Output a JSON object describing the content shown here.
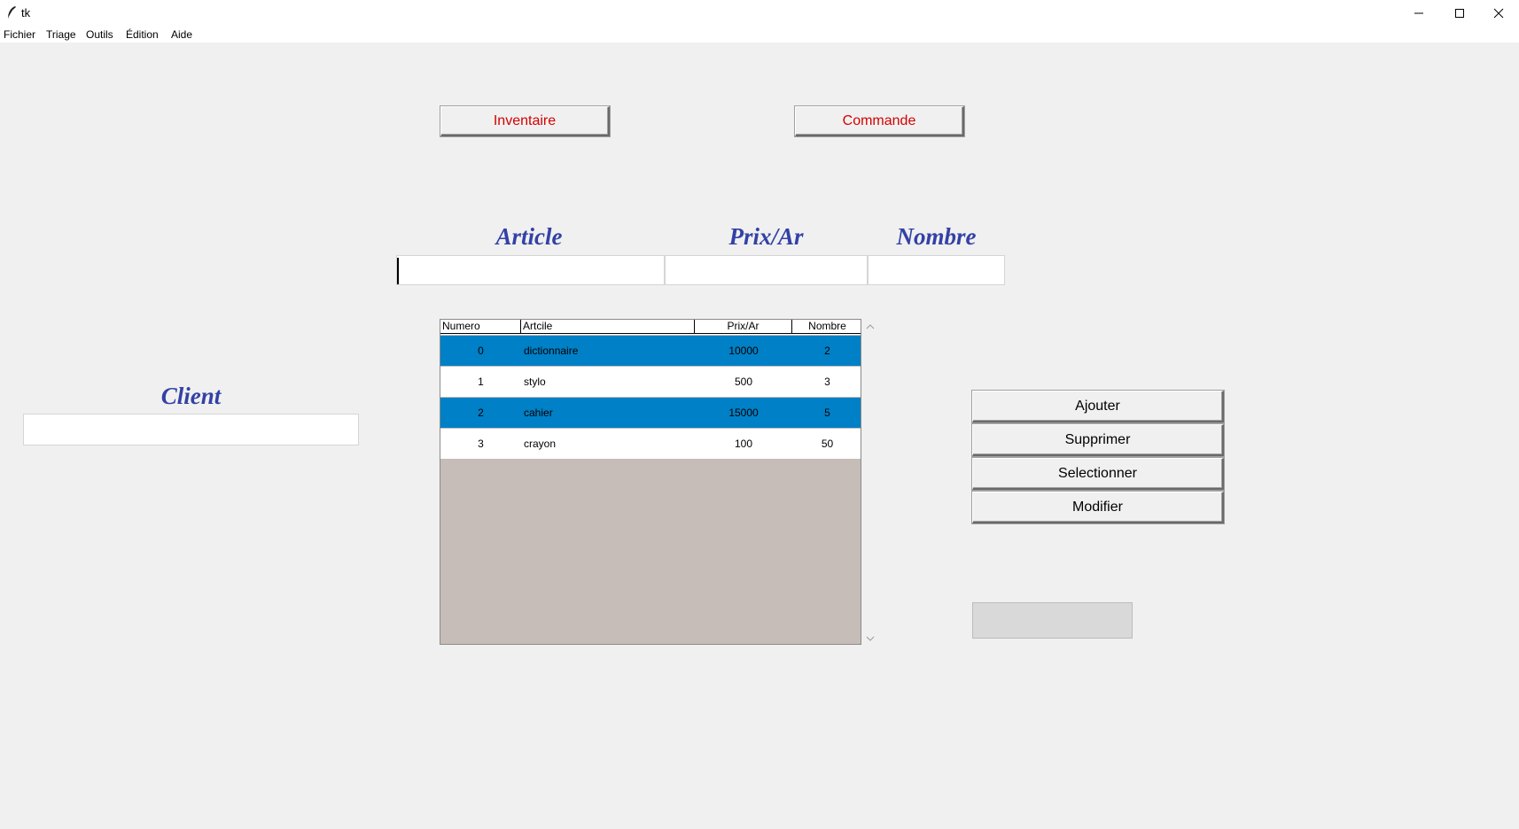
{
  "window": {
    "title": "tk"
  },
  "menubar": {
    "items": [
      "Fichier",
      "Triage",
      "Outils",
      "Édition",
      "Aide"
    ]
  },
  "nav": {
    "inventaire": "Inventaire",
    "commande": "Commande"
  },
  "labels": {
    "article": "Article",
    "prix": "Prix/Ar",
    "nombre": "Nombre",
    "client": "Client"
  },
  "inputs": {
    "article": "",
    "prix": "",
    "nombre": "",
    "client": ""
  },
  "table": {
    "columns": [
      "Numero",
      "Artcile",
      "Prix/Ar",
      "Nombre"
    ],
    "rows": [
      {
        "numero": "0",
        "article": "dictionnaire",
        "prix": "10000",
        "nombre": "2",
        "selected": true
      },
      {
        "numero": "1",
        "article": "stylo",
        "prix": "500",
        "nombre": "3",
        "selected": false
      },
      {
        "numero": "2",
        "article": "cahier",
        "prix": "15000",
        "nombre": "5",
        "selected": true
      },
      {
        "numero": "3",
        "article": "crayon",
        "prix": "100",
        "nombre": "50",
        "selected": false
      }
    ]
  },
  "actions": {
    "ajouter": "Ajouter",
    "supprimer": "Supprimer",
    "selectionner": "Selectionner",
    "modifier": "Modifier"
  },
  "colors": {
    "selected_row": "#0080c6",
    "label_blue": "#3341a6",
    "nav_red": "#d40000",
    "table_empty": "#c6bcb8"
  },
  "icons": {
    "app": "feather-icon",
    "minimize": "minimize-icon",
    "maximize": "maximize-icon",
    "close": "close-icon",
    "scroll_up": "chevron-up-icon",
    "scroll_down": "chevron-down-icon"
  }
}
